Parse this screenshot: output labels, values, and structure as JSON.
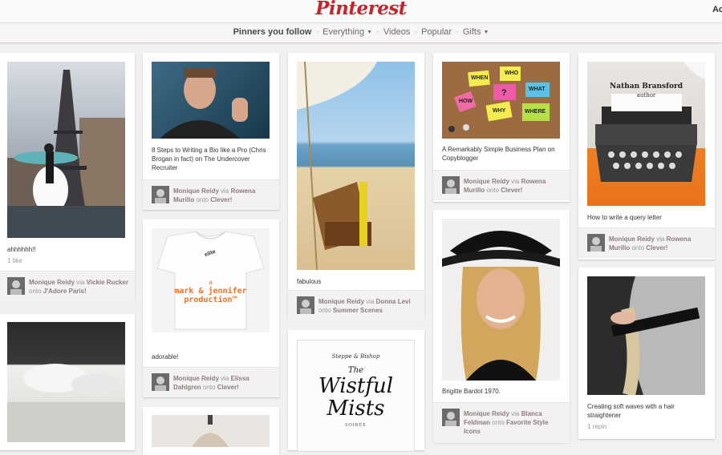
{
  "brand": {
    "logo": "Pinterest",
    "account_partial": "Ac"
  },
  "subnav": {
    "following": "Pinners you follow",
    "everything": "Everything",
    "videos": "Videos",
    "popular": "Popular",
    "gifts": "Gifts",
    "dropdown_icon": "caret-down-icon"
  },
  "pins": [
    {
      "id": "p1",
      "description": "ahhhhhh!!",
      "stats": "1 like",
      "pinner": "Monique Reidy",
      "via_word": "via",
      "via": "Vickie Rucker",
      "onto_word": "onto",
      "board": "J'Adore Paris!"
    },
    {
      "id": "p2",
      "description": "8 Steps to Writing a Bio like a Pro (Chris Brogan in fact) on The Undercover Recruiter",
      "pinner": "Monique Reidy",
      "via_word": "via",
      "via": "Rowena Murillo",
      "onto_word": "onto",
      "board": "Clever!"
    },
    {
      "id": "p3",
      "description": "adorable!",
      "pinner": "Monique Reidy",
      "via_word": "via",
      "via": "Elissa Dahlgren",
      "onto_word": "onto",
      "board": "Clever!",
      "image_text_a": "a",
      "image_text_b": "mark & jennifer",
      "image_text_c": "production™",
      "shirt_label": "elite"
    },
    {
      "id": "p4",
      "description": "fabulous",
      "pinner": "Monique Reidy",
      "via_word": "via",
      "via": "Donna Levi",
      "onto_word": "onto",
      "board": "Summer Scenes"
    },
    {
      "id": "p5",
      "image_text_top": "Steppe & Bishop",
      "image_text_the": "The",
      "image_text_title1": "Wistful",
      "image_text_title2": "Mists",
      "image_text_bottom": "SOIRÉE"
    },
    {
      "id": "p6",
      "description": "A Remarkably Simple Business Plan on Copyblogger",
      "pinner": "Monique Reidy",
      "via_word": "via",
      "via": "Rowena Murillo",
      "onto_word": "onto",
      "board": "Clever!",
      "notes": [
        "WHEN",
        "WHO",
        "HOW",
        "?",
        "WHAT",
        "WHY",
        "WHERE"
      ]
    },
    {
      "id": "p7",
      "description": "Brigitte Bardot 1970.",
      "pinner": "Monique Reidy",
      "via_word": "via",
      "via": "Blanca Feldman",
      "onto_word": "onto",
      "board": "Favorite Style Icons"
    },
    {
      "id": "p8",
      "description": "How to write a query letter",
      "pinner": "Monique Reidy",
      "via_word": "via",
      "via": "Rowena Murillo",
      "onto_word": "onto",
      "board": "Clever!",
      "image_text_name": "Nathan Bransford",
      "image_text_role": "author"
    },
    {
      "id": "p9",
      "description": "Creating soft waves with a hair straightener",
      "stats": "1 repin"
    }
  ]
}
